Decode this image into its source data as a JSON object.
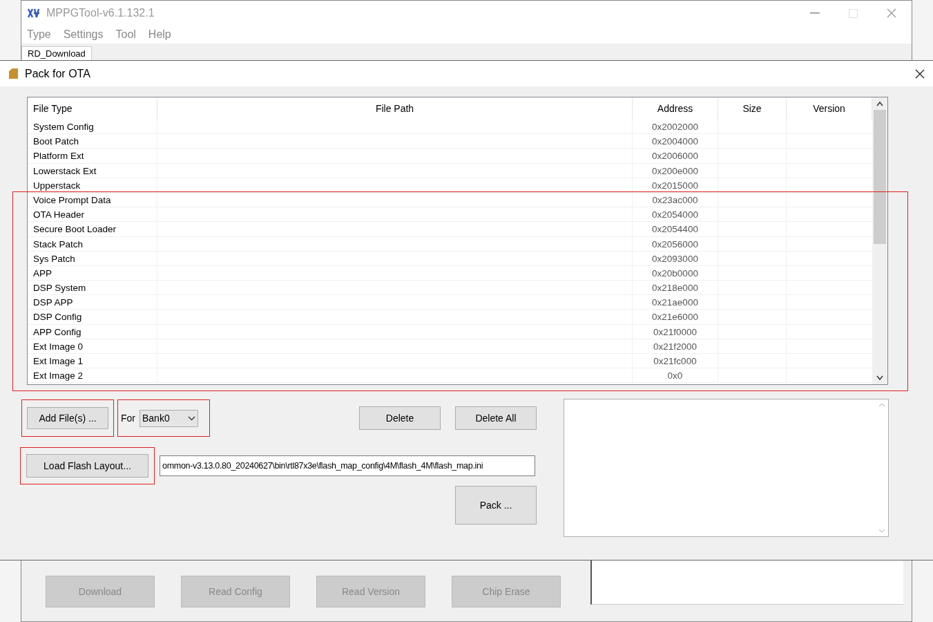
{
  "main_window": {
    "title": "MPPGTool-v6.1.132.1",
    "menu": [
      "Type",
      "Settings",
      "Tool",
      "Help"
    ],
    "tab": {
      "label": "RD_Download",
      "selected": true
    }
  },
  "dialog": {
    "title": "Pack for OTA",
    "table": {
      "columns": [
        "File Type",
        "File Path",
        "Address",
        "Size",
        "Version"
      ],
      "rows": [
        {
          "file_type": "System Config",
          "address": "0x2002000"
        },
        {
          "file_type": "Boot Patch",
          "address": "0x2004000"
        },
        {
          "file_type": "Platform Ext",
          "address": "0x2006000"
        },
        {
          "file_type": "Lowerstack Ext",
          "address": "0x200e000"
        },
        {
          "file_type": "Upperstack",
          "address": "0x2015000"
        },
        {
          "file_type": "Voice Prompt Data",
          "address": "0x23ac000"
        },
        {
          "file_type": "OTA Header",
          "address": "0x2054000"
        },
        {
          "file_type": "Secure Boot Loader",
          "address": "0x2054400"
        },
        {
          "file_type": "Stack Patch",
          "address": "0x2056000"
        },
        {
          "file_type": "Sys Patch",
          "address": "0x2093000"
        },
        {
          "file_type": "APP",
          "address": "0x20b0000"
        },
        {
          "file_type": "DSP System",
          "address": "0x218e000"
        },
        {
          "file_type": "DSP APP",
          "address": "0x21ae000"
        },
        {
          "file_type": "DSP Config",
          "address": "0x21e6000"
        },
        {
          "file_type": "APP Config",
          "address": "0x21f0000"
        },
        {
          "file_type": "Ext Image 0",
          "address": "0x21f2000"
        },
        {
          "file_type": "Ext Image 1",
          "address": "0x21fc000"
        },
        {
          "file_type": "Ext Image 2",
          "address": "0x0"
        }
      ]
    },
    "add_files_button": "Add File(s) ...",
    "for_label": "For",
    "bank_select": "Bank0",
    "delete_button": "Delete",
    "delete_all_button": "Delete All",
    "load_layout_button": "Load Flash Layout...",
    "layout_path": "ommon-v3.13.0.80_20240627\\bin\\rtl87x3e\\flash_map_config\\4M\\flash_4M\\flash_map.ini",
    "pack_button": "Pack ..."
  },
  "bottom_buttons": [
    {
      "label": "Download",
      "disabled": true
    },
    {
      "label": "Read Config",
      "disabled": true
    },
    {
      "label": "Read Version",
      "disabled": true
    },
    {
      "label": "Chip Erase",
      "disabled": true
    }
  ]
}
